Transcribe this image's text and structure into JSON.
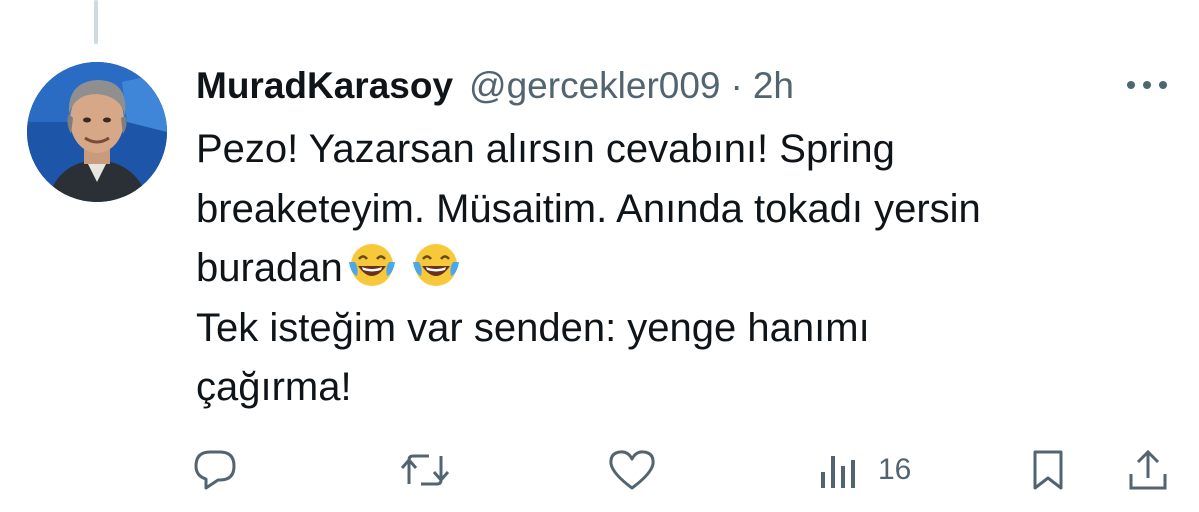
{
  "tweet": {
    "display_name": "MuradKarasoy",
    "handle": "@gercekler009",
    "separator": "·",
    "time": "2h",
    "text_lines": [
      "Pezo! Yazarsan alırsın cevabını! Spring",
      "breaketeyim. Müsaitim. Anında tokadı yersin",
      "buradan",
      "Tek isteğim var senden: yenge hanımı",
      "çağırma!"
    ],
    "emoji": [
      "face-with-tears-of-joy",
      "face-with-tears-of-joy"
    ]
  },
  "actions": {
    "reply": {
      "icon": "reply-icon"
    },
    "retweet": {
      "icon": "retweet-icon"
    },
    "like": {
      "icon": "heart-icon"
    },
    "views": {
      "icon": "views-icon",
      "count": "16"
    },
    "bookmark": {
      "icon": "bookmark-icon"
    },
    "share": {
      "icon": "share-icon"
    }
  },
  "colors": {
    "text_primary": "#0f1419",
    "text_secondary": "#536471",
    "thread_line": "#cfd9de",
    "emoji_yellow": "#f7c83a",
    "tear_blue": "#4aa7e8"
  }
}
